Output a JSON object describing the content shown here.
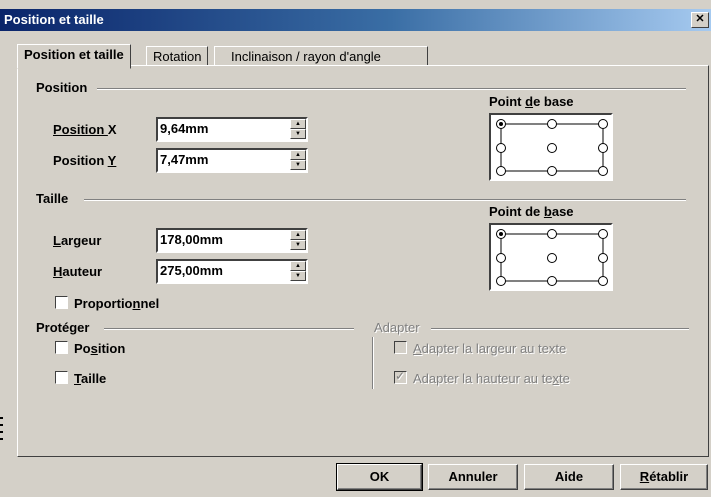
{
  "window": {
    "title": "Position et taille",
    "close_glyph": "✕"
  },
  "tabs": [
    {
      "label": "Position et taille",
      "active": true
    },
    {
      "label": "Rotation",
      "active": false
    },
    {
      "label": "Inclinaison / rayon d'angle",
      "active": false
    }
  ],
  "position": {
    "group_label": "Position",
    "x_label_pre": "Position ",
    "x_label_key": "X",
    "x_value": "9,64mm",
    "y_label_pre": "Position ",
    "y_label_key": "Y",
    "y_value": "7,47mm",
    "base_point_pre": "Point ",
    "base_point_key": "d",
    "base_point_post": "e base"
  },
  "size": {
    "group_label": "Taille",
    "width_label_key": "L",
    "width_label_post": "argeur",
    "width_value": "178,00mm",
    "height_label_key": "H",
    "height_label_post": "auteur",
    "height_value": "275,00mm",
    "base_point_pre": "Point de ",
    "base_point_key": "b",
    "base_point_post": "ase",
    "keep_ratio_pre": "Proportio",
    "keep_ratio_key": "n",
    "keep_ratio_post": "nel",
    "keep_ratio_checked": false
  },
  "protect": {
    "group_label": "Protéger",
    "position_pre": "Po",
    "position_key": "s",
    "position_post": "ition",
    "position_checked": false,
    "size_key": "T",
    "size_post": "aille",
    "size_checked": false
  },
  "fit": {
    "group_label": "Adapter",
    "width_key": "A",
    "width_post": "dapter la largeur au texte",
    "width_checked": false,
    "height_pre": "Adapter la hauteur au te",
    "height_key": "x",
    "height_post": "te",
    "height_checked": true
  },
  "buttons": {
    "ok": "OK",
    "cancel": "Annuler",
    "help": "Aide",
    "reset_key": "R",
    "reset_post": "établir"
  }
}
